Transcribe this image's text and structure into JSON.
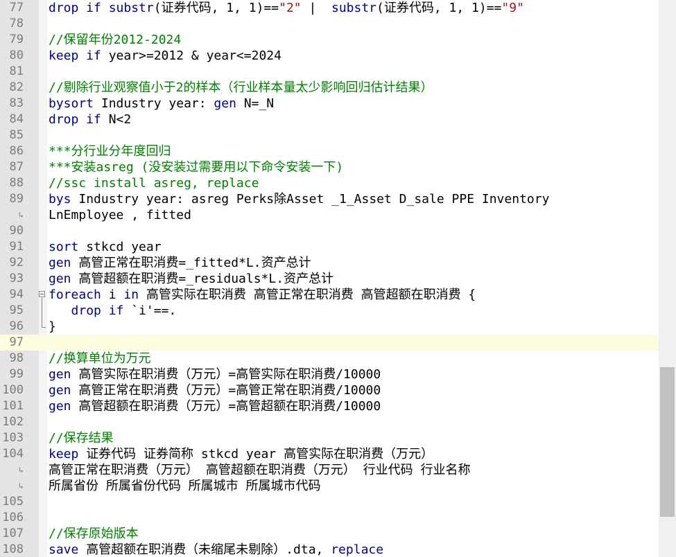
{
  "editor": {
    "lines": [
      {
        "num": "77",
        "parts": [
          [
            "kw",
            "drop if "
          ],
          [
            "kw",
            "substr"
          ],
          [
            "",
            "(证券代码, 1, 1)=="
          ],
          [
            "str",
            "\"2\""
          ],
          [
            "",
            " |  "
          ],
          [
            "kw",
            "substr"
          ],
          [
            "",
            "(证券代码, 1, 1)=="
          ],
          [
            "str",
            "\"9\""
          ]
        ]
      },
      {
        "num": "78",
        "parts": []
      },
      {
        "num": "79",
        "parts": [
          [
            "com",
            "//保留年份2012-2024"
          ]
        ]
      },
      {
        "num": "80",
        "parts": [
          [
            "kw",
            "keep if "
          ],
          [
            "",
            "year>=2012 & year<=2024"
          ]
        ]
      },
      {
        "num": "81",
        "parts": []
      },
      {
        "num": "82",
        "parts": [
          [
            "com",
            "//剔除行业观察值小于2的样本（行业样本量太少影响回归估计结果）"
          ]
        ]
      },
      {
        "num": "83",
        "parts": [
          [
            "kw",
            "bysort "
          ],
          [
            "",
            "Industry year: "
          ],
          [
            "kw",
            "gen "
          ],
          [
            "",
            "N=_N"
          ]
        ]
      },
      {
        "num": "84",
        "parts": [
          [
            "kw",
            "drop if "
          ],
          [
            "",
            "N<2"
          ]
        ]
      },
      {
        "num": "85",
        "parts": []
      },
      {
        "num": "86",
        "parts": [
          [
            "com",
            "***分行业分年度回归"
          ]
        ]
      },
      {
        "num": "87",
        "parts": [
          [
            "com",
            "***安装asreg (没安装过需要用以下命令安装一下)"
          ]
        ]
      },
      {
        "num": "88",
        "parts": [
          [
            "com",
            "//ssc install asreg, replace"
          ]
        ]
      },
      {
        "num": "89",
        "parts": [
          [
            "kw",
            "bys "
          ],
          [
            "",
            "Industry year: asreg Perks除Asset _1_Asset D_sale PPE Inventory"
          ]
        ]
      },
      {
        "num": "",
        "wrap": true,
        "parts": [
          [
            "",
            "LnEmployee , fitted"
          ]
        ]
      },
      {
        "num": "90",
        "parts": []
      },
      {
        "num": "91",
        "parts": [
          [
            "kw",
            "sort "
          ],
          [
            "",
            "stkcd year"
          ]
        ]
      },
      {
        "num": "92",
        "parts": [
          [
            "kw",
            "gen "
          ],
          [
            "",
            "高管正常在职消费=_fitted*L.资产总计"
          ]
        ]
      },
      {
        "num": "93",
        "parts": [
          [
            "kw",
            "gen "
          ],
          [
            "",
            "高管超额在职消费=_residuals*L.资产总计"
          ]
        ]
      },
      {
        "num": "94",
        "fold": true,
        "parts": [
          [
            "kw",
            "foreach "
          ],
          [
            "",
            "i "
          ],
          [
            "kw",
            "in "
          ],
          [
            "",
            "高管实际在职消费 高管正常在职消费 高管超额在职消费 {"
          ]
        ]
      },
      {
        "num": "95",
        "parts": [
          [
            "",
            "   "
          ],
          [
            "kw",
            "drop if "
          ],
          [
            "",
            "`i'==."
          ]
        ]
      },
      {
        "num": "96",
        "parts": [
          [
            "",
            "}"
          ]
        ]
      },
      {
        "num": "97",
        "current": true,
        "parts": []
      },
      {
        "num": "98",
        "parts": [
          [
            "com",
            "//换算单位为万元"
          ]
        ]
      },
      {
        "num": "99",
        "parts": [
          [
            "kw",
            "gen "
          ],
          [
            "",
            "高管实际在职消费（万元）=高管实际在职消费/10000"
          ]
        ]
      },
      {
        "num": "100",
        "parts": [
          [
            "kw",
            "gen "
          ],
          [
            "",
            "高管正常在职消费（万元）=高管正常在职消费/10000"
          ]
        ]
      },
      {
        "num": "101",
        "parts": [
          [
            "kw",
            "gen "
          ],
          [
            "",
            "高管超额在职消费（万元）=高管超额在职消费/10000"
          ]
        ]
      },
      {
        "num": "102",
        "parts": []
      },
      {
        "num": "103",
        "parts": [
          [
            "com",
            "//保存结果"
          ]
        ]
      },
      {
        "num": "104",
        "parts": [
          [
            "kw",
            "keep "
          ],
          [
            "",
            "证券代码 证券简称 stkcd year 高管实际在职消费（万元）"
          ]
        ]
      },
      {
        "num": "",
        "wrap": true,
        "parts": [
          [
            "",
            "高管正常在职消费（万元） 高管超额在职消费（万元） 行业代码 行业名称"
          ]
        ]
      },
      {
        "num": "",
        "wrap": true,
        "parts": [
          [
            "",
            "所属省份 所属省份代码 所属城市 所属城市代码"
          ]
        ]
      },
      {
        "num": "105",
        "parts": []
      },
      {
        "num": "106",
        "parts": []
      },
      {
        "num": "107",
        "parts": [
          [
            "com",
            "//保存原始版本"
          ]
        ]
      },
      {
        "num": "108",
        "parts": [
          [
            "kw",
            "save "
          ],
          [
            "",
            "高管超额在职消费（未缩尾未剔除）.dta, "
          ],
          [
            "kw",
            "replace"
          ]
        ]
      }
    ],
    "wrap_marker": "↳",
    "scroll_position": 0.82
  }
}
